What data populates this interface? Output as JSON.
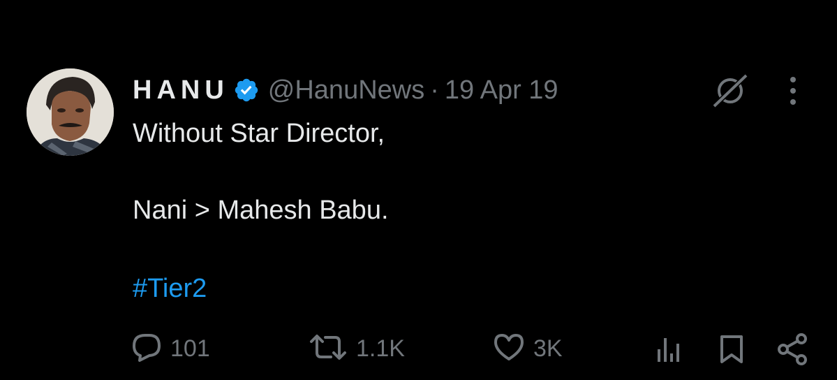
{
  "tweet": {
    "display_name": "HANU",
    "handle": "@HanuNews",
    "separator": "·",
    "date": "19 Apr 19",
    "lines": [
      "Without Star Director,",
      "Nani > Mahesh Babu."
    ],
    "hashtag": "#Tier2"
  },
  "actions": {
    "replies": "101",
    "reposts": "1.1K",
    "likes": "3K"
  },
  "colors": {
    "background": "#000000",
    "text": "#e7e9ea",
    "muted": "#71767b",
    "link": "#1d9bf0",
    "verified": "#1d9bf0"
  },
  "icons": [
    "verified-badge-icon",
    "grok-icon",
    "more-icon",
    "reply-icon",
    "repost-icon",
    "like-icon",
    "views-icon",
    "bookmark-icon",
    "share-icon"
  ]
}
